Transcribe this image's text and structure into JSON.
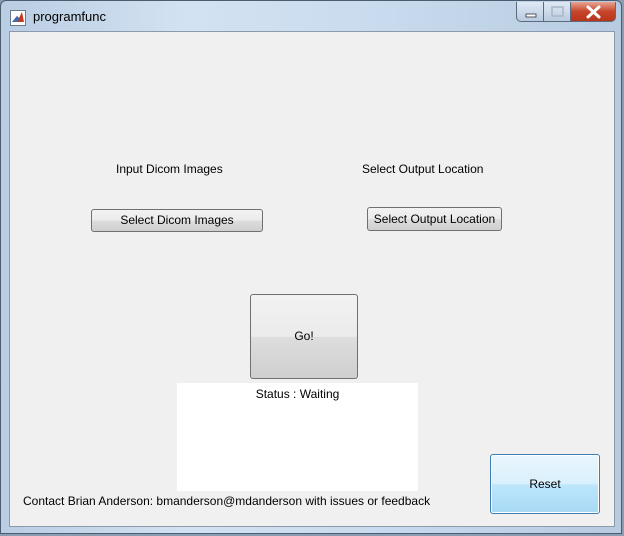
{
  "window": {
    "title": "programfunc"
  },
  "labels": {
    "input": "Input Dicom Images",
    "output": "Select Output Location",
    "contact": "Contact Brian Anderson: bmanderson@mdanderson with issues or feedback"
  },
  "buttons": {
    "select_dicom": "Select Dicom Images",
    "select_output": "Select Output Location",
    "go": "Go!",
    "reset": "Reset"
  },
  "status": {
    "text": "Status : Waiting"
  },
  "icons": {
    "app": "matlab-icon",
    "minimize": "minimize-icon",
    "maximize": "maximize-icon",
    "close": "close-icon"
  },
  "colors": {
    "close_button": "#c7452b",
    "reset_button": "#bee6fd",
    "panel_background": "#f0f0f0"
  }
}
